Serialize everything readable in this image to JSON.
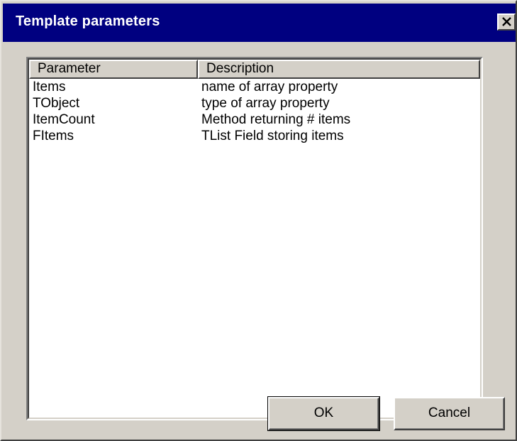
{
  "window": {
    "title": "Template parameters",
    "close_icon": "close-icon"
  },
  "list": {
    "columns": [
      {
        "label": "Parameter"
      },
      {
        "label": "Description"
      }
    ],
    "rows": [
      {
        "parameter": "Items",
        "description": "name of array property"
      },
      {
        "parameter": "TObject",
        "description": "type of array property"
      },
      {
        "parameter": "ItemCount",
        "description": "Method returning # items"
      },
      {
        "parameter": "FItems",
        "description": "TList Field storing items"
      }
    ]
  },
  "buttons": {
    "ok_label": "OK",
    "cancel_label": "Cancel"
  },
  "colors": {
    "titlebar": "#000080",
    "face": "#d4d0c8"
  }
}
